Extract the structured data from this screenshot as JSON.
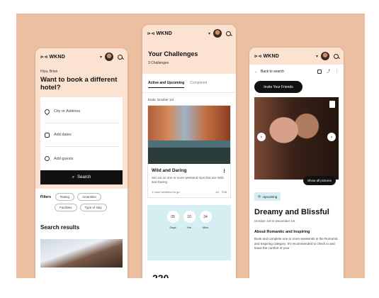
{
  "brand": {
    "logo_text": "WKND",
    "logo_mark": "⊳⊲"
  },
  "search_page": {
    "greeting": "Hiya, Brian",
    "title": "Want to book a different hotel?",
    "fields": {
      "location_placeholder": "City or Address",
      "dates_placeholder": "Add dates",
      "guests_placeholder": "Add guests"
    },
    "search_button": "Search",
    "filters_label": "Filters",
    "chips": [
      "Rating",
      "Amenities",
      "Facilities",
      "Type of stay"
    ],
    "results_heading": "Search results"
  },
  "challenges_page": {
    "title": "Your Challenges",
    "subtitle": "3 Challenges",
    "tabs": [
      "Active and Upcoming",
      "Completed"
    ],
    "ends_text": "Ends: October 1st",
    "card": {
      "title": "Wild and Daring",
      "description": "Set out on one or more weekend trips that are Wild and Daring",
      "progress_text": "1 more weekend to go",
      "meta_left": "4d",
      "meta_right": "7/48"
    },
    "timer": [
      {
        "value": "05",
        "label": "Days"
      },
      {
        "value": "10",
        "label": "Hrs"
      },
      {
        "value": "34",
        "label": "Mins"
      }
    ],
    "next_card_number": "220"
  },
  "detail_page": {
    "back_label": "Back to search",
    "invite_button": "Invite Your Friends",
    "show_pictures_button": "Show all pictures",
    "badge": "Upcoming",
    "title": "Dreamy and Blissful",
    "dates": "October 1st to December 1st",
    "about_heading": "About Romantic and Inspiring",
    "about_body": "Book and complete one or more weekends in the Romantic and Inspiring category. It's recommended to check in and leave the comfort of your"
  },
  "colors": {
    "panel": "#ebbf9f",
    "header": "#fbe2d1",
    "teal": "#d4eef2",
    "dark": "#111111"
  },
  "icons": [
    "logo-mark-icon",
    "avatar",
    "caret-down-icon",
    "search-icon",
    "location-pin-icon",
    "calendar-icon",
    "guests-icon",
    "more-icon",
    "bookmark-icon",
    "arrow-left-icon",
    "arrow-right-icon",
    "share-icon",
    "tag-icon"
  ]
}
